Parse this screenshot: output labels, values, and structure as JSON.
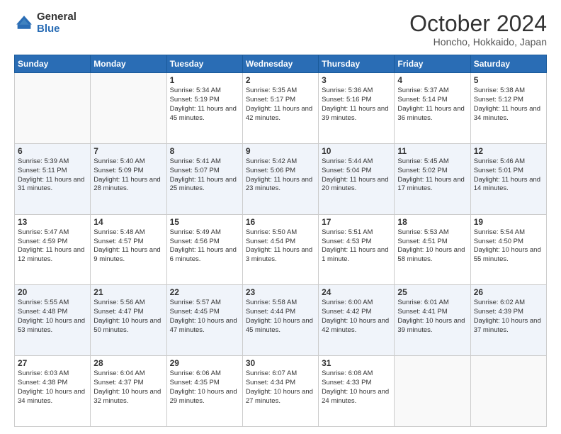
{
  "logo": {
    "general": "General",
    "blue": "Blue"
  },
  "title": {
    "month": "October 2024",
    "location": "Honcho, Hokkaido, Japan"
  },
  "weekdays": [
    "Sunday",
    "Monday",
    "Tuesday",
    "Wednesday",
    "Thursday",
    "Friday",
    "Saturday"
  ],
  "weeks": [
    [
      {
        "day": "",
        "info": ""
      },
      {
        "day": "",
        "info": ""
      },
      {
        "day": "1",
        "info": "Sunrise: 5:34 AM\nSunset: 5:19 PM\nDaylight: 11 hours and 45 minutes."
      },
      {
        "day": "2",
        "info": "Sunrise: 5:35 AM\nSunset: 5:17 PM\nDaylight: 11 hours and 42 minutes."
      },
      {
        "day": "3",
        "info": "Sunrise: 5:36 AM\nSunset: 5:16 PM\nDaylight: 11 hours and 39 minutes."
      },
      {
        "day": "4",
        "info": "Sunrise: 5:37 AM\nSunset: 5:14 PM\nDaylight: 11 hours and 36 minutes."
      },
      {
        "day": "5",
        "info": "Sunrise: 5:38 AM\nSunset: 5:12 PM\nDaylight: 11 hours and 34 minutes."
      }
    ],
    [
      {
        "day": "6",
        "info": "Sunrise: 5:39 AM\nSunset: 5:11 PM\nDaylight: 11 hours and 31 minutes."
      },
      {
        "day": "7",
        "info": "Sunrise: 5:40 AM\nSunset: 5:09 PM\nDaylight: 11 hours and 28 minutes."
      },
      {
        "day": "8",
        "info": "Sunrise: 5:41 AM\nSunset: 5:07 PM\nDaylight: 11 hours and 25 minutes."
      },
      {
        "day": "9",
        "info": "Sunrise: 5:42 AM\nSunset: 5:06 PM\nDaylight: 11 hours and 23 minutes."
      },
      {
        "day": "10",
        "info": "Sunrise: 5:44 AM\nSunset: 5:04 PM\nDaylight: 11 hours and 20 minutes."
      },
      {
        "day": "11",
        "info": "Sunrise: 5:45 AM\nSunset: 5:02 PM\nDaylight: 11 hours and 17 minutes."
      },
      {
        "day": "12",
        "info": "Sunrise: 5:46 AM\nSunset: 5:01 PM\nDaylight: 11 hours and 14 minutes."
      }
    ],
    [
      {
        "day": "13",
        "info": "Sunrise: 5:47 AM\nSunset: 4:59 PM\nDaylight: 11 hours and 12 minutes."
      },
      {
        "day": "14",
        "info": "Sunrise: 5:48 AM\nSunset: 4:57 PM\nDaylight: 11 hours and 9 minutes."
      },
      {
        "day": "15",
        "info": "Sunrise: 5:49 AM\nSunset: 4:56 PM\nDaylight: 11 hours and 6 minutes."
      },
      {
        "day": "16",
        "info": "Sunrise: 5:50 AM\nSunset: 4:54 PM\nDaylight: 11 hours and 3 minutes."
      },
      {
        "day": "17",
        "info": "Sunrise: 5:51 AM\nSunset: 4:53 PM\nDaylight: 11 hours and 1 minute."
      },
      {
        "day": "18",
        "info": "Sunrise: 5:53 AM\nSunset: 4:51 PM\nDaylight: 10 hours and 58 minutes."
      },
      {
        "day": "19",
        "info": "Sunrise: 5:54 AM\nSunset: 4:50 PM\nDaylight: 10 hours and 55 minutes."
      }
    ],
    [
      {
        "day": "20",
        "info": "Sunrise: 5:55 AM\nSunset: 4:48 PM\nDaylight: 10 hours and 53 minutes."
      },
      {
        "day": "21",
        "info": "Sunrise: 5:56 AM\nSunset: 4:47 PM\nDaylight: 10 hours and 50 minutes."
      },
      {
        "day": "22",
        "info": "Sunrise: 5:57 AM\nSunset: 4:45 PM\nDaylight: 10 hours and 47 minutes."
      },
      {
        "day": "23",
        "info": "Sunrise: 5:58 AM\nSunset: 4:44 PM\nDaylight: 10 hours and 45 minutes."
      },
      {
        "day": "24",
        "info": "Sunrise: 6:00 AM\nSunset: 4:42 PM\nDaylight: 10 hours and 42 minutes."
      },
      {
        "day": "25",
        "info": "Sunrise: 6:01 AM\nSunset: 4:41 PM\nDaylight: 10 hours and 39 minutes."
      },
      {
        "day": "26",
        "info": "Sunrise: 6:02 AM\nSunset: 4:39 PM\nDaylight: 10 hours and 37 minutes."
      }
    ],
    [
      {
        "day": "27",
        "info": "Sunrise: 6:03 AM\nSunset: 4:38 PM\nDaylight: 10 hours and 34 minutes."
      },
      {
        "day": "28",
        "info": "Sunrise: 6:04 AM\nSunset: 4:37 PM\nDaylight: 10 hours and 32 minutes."
      },
      {
        "day": "29",
        "info": "Sunrise: 6:06 AM\nSunset: 4:35 PM\nDaylight: 10 hours and 29 minutes."
      },
      {
        "day": "30",
        "info": "Sunrise: 6:07 AM\nSunset: 4:34 PM\nDaylight: 10 hours and 27 minutes."
      },
      {
        "day": "31",
        "info": "Sunrise: 6:08 AM\nSunset: 4:33 PM\nDaylight: 10 hours and 24 minutes."
      },
      {
        "day": "",
        "info": ""
      },
      {
        "day": "",
        "info": ""
      }
    ]
  ]
}
